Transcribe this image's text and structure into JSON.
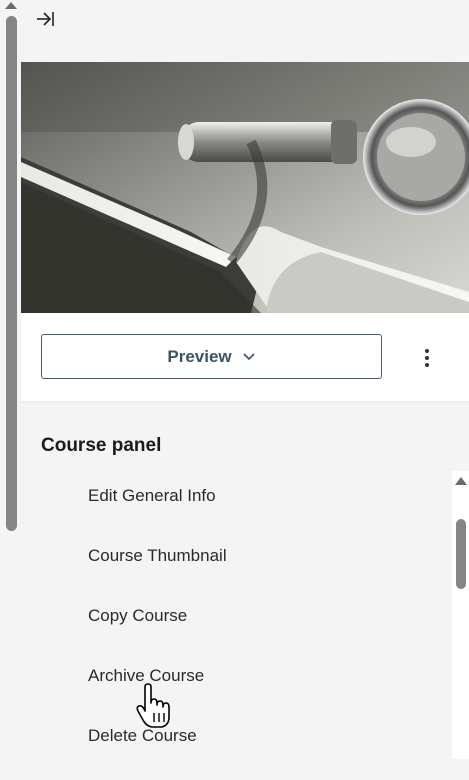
{
  "preview_button": {
    "label": "Preview"
  },
  "course_panel": {
    "title": "Course panel",
    "items": [
      {
        "label": "Edit General Info"
      },
      {
        "label": "Course Thumbnail"
      },
      {
        "label": "Copy Course"
      },
      {
        "label": "Archive Course"
      },
      {
        "label": "Delete Course"
      }
    ]
  },
  "icons": {
    "collapse": "collapse-to-right-icon",
    "preview_dropdown": "chevron-down-icon",
    "more_options": "kebab-menu-icon",
    "cursor": "hand-pointer-icon"
  }
}
